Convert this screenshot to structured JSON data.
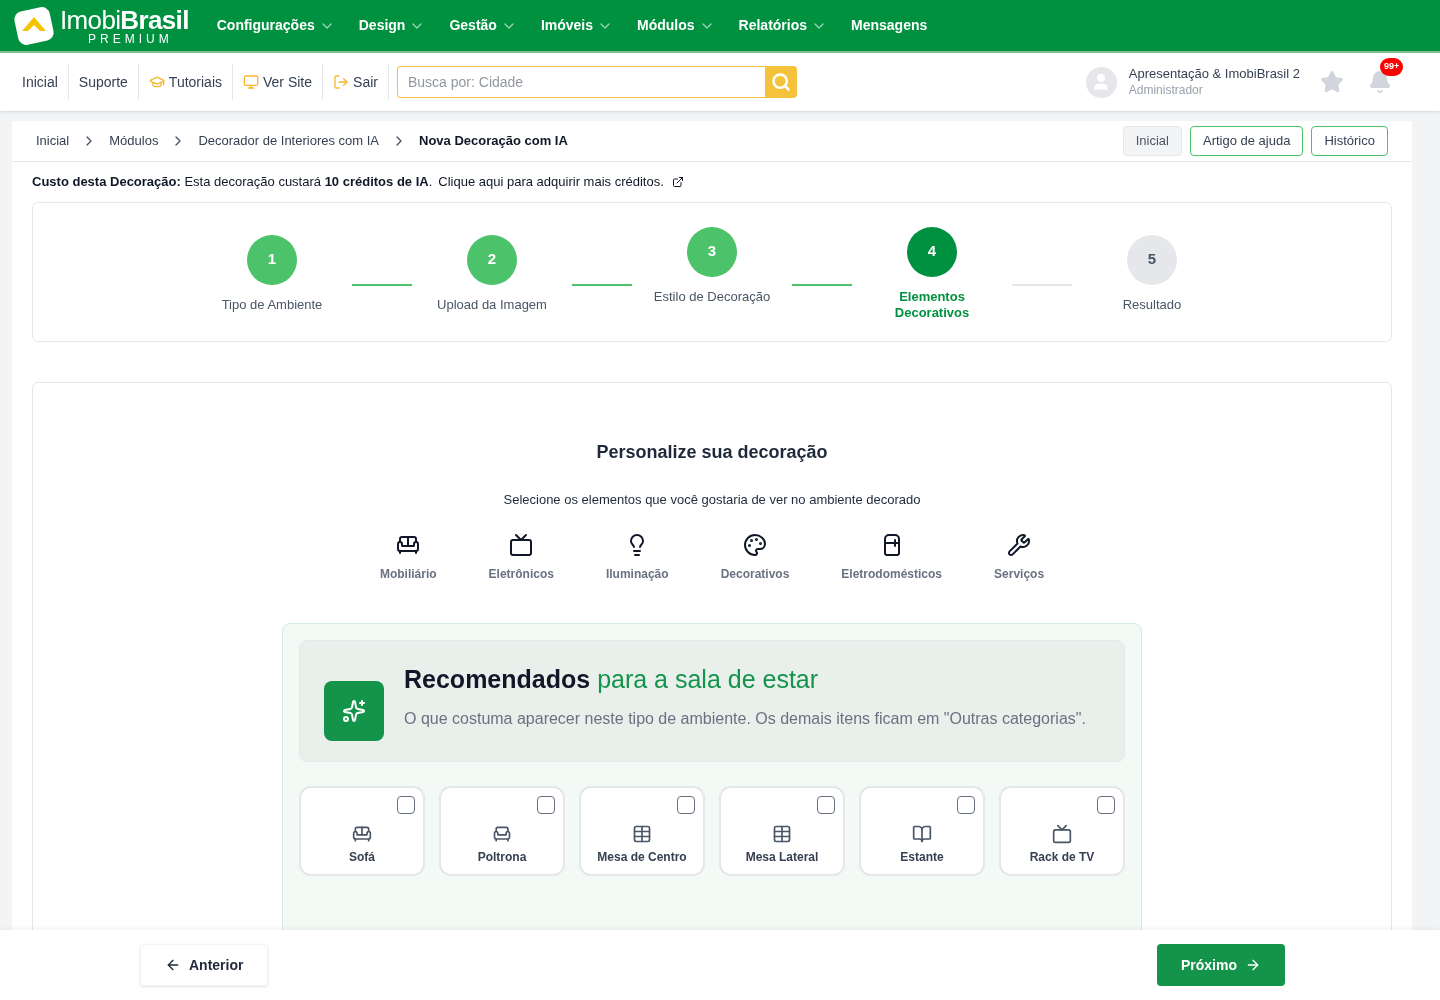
{
  "logo": {
    "name": "Imobi**Brasil**",
    "tagline": "PREMIUM"
  },
  "main_menu": [
    {
      "label": "Configurações",
      "dropdown": true
    },
    {
      "label": "Design",
      "dropdown": true
    },
    {
      "label": "Gestão",
      "dropdown": true
    },
    {
      "label": "Imóveis",
      "dropdown": true
    },
    {
      "label": "Módulos",
      "dropdown": true
    },
    {
      "label": "Relatórios",
      "dropdown": true
    },
    {
      "label": "Mensagens",
      "dropdown": false
    }
  ],
  "toolbar": {
    "links": [
      {
        "label": "Inicial",
        "kind": "plain"
      },
      {
        "label": "Suporte",
        "kind": "plain"
      },
      {
        "label": "Tutoriais",
        "kind": "cap"
      },
      {
        "label": "Ver Site",
        "kind": "monitor"
      },
      {
        "label": "Sair",
        "kind": "exit"
      }
    ],
    "search": {
      "placeholder": "Busca por: Cidade"
    },
    "user": {
      "name": "Apresentação & ImobiBrasil 2",
      "role": "Administrador"
    },
    "notifications": "99+"
  },
  "breadcrumb": [
    "Inicial",
    "Módulos",
    "Decorador de Interiores com IA",
    "Nova Decoração com IA"
  ],
  "header_buttons": [
    "Inicial",
    "Artigo de ajuda",
    "Histórico"
  ],
  "cost_notice": {
    "text": "**Custo desta Decoração:** Esta decoração custará **10 créditos de IA**.",
    "link": "Clique aqui para adquirir mais créditos."
  },
  "steps": [
    {
      "number": "1",
      "label": "Tipo de Ambiente",
      "done": true,
      "selected": false
    },
    {
      "number": "2",
      "label": "Upload da Imagem",
      "done": true,
      "selected": false
    },
    {
      "number": "3",
      "label": "Estilo de Decoração",
      "done": true,
      "selected": false
    },
    {
      "number": "4",
      "label": "Elementos Decorativos",
      "done": false,
      "selected": true
    },
    {
      "number": "5",
      "label": "Resultado",
      "done": false,
      "selected": false
    }
  ],
  "section": {
    "title": "Personalize sua decoração",
    "subtitle": "Selecione os elementos que você gostaria de ver no ambiente decorado"
  },
  "categories": [
    {
      "label": "Mobiliário",
      "kind": "sofa"
    },
    {
      "label": "Eletrônicos",
      "kind": "tv"
    },
    {
      "label": "Iluminação",
      "kind": "bulb"
    },
    {
      "label": "Decorativos",
      "kind": "palette"
    },
    {
      "label": "Eletrodomésticos",
      "kind": "fridge"
    },
    {
      "label": "Serviços",
      "kind": "wrench"
    }
  ],
  "recommended": {
    "title": "Recomendados",
    "title_rest": "para a sala de estar",
    "text": "O que costuma aparecer neste tipo de ambiente. Os demais itens ficam em \"Outras categorias\"."
  },
  "items": [
    {
      "label": "Sofá",
      "kind": "sofa",
      "checked": false
    },
    {
      "label": "Poltrona",
      "kind": "armchair",
      "checked": false
    },
    {
      "label": "Mesa de Centro",
      "kind": "table",
      "checked": false
    },
    {
      "label": "Mesa Lateral",
      "kind": "table",
      "checked": false
    },
    {
      "label": "Estante",
      "kind": "book",
      "checked": false
    },
    {
      "label": "Rack de TV",
      "kind": "tv",
      "checked": false
    }
  ],
  "footer": {
    "previous": "Anterior",
    "next": "Próximo"
  }
}
